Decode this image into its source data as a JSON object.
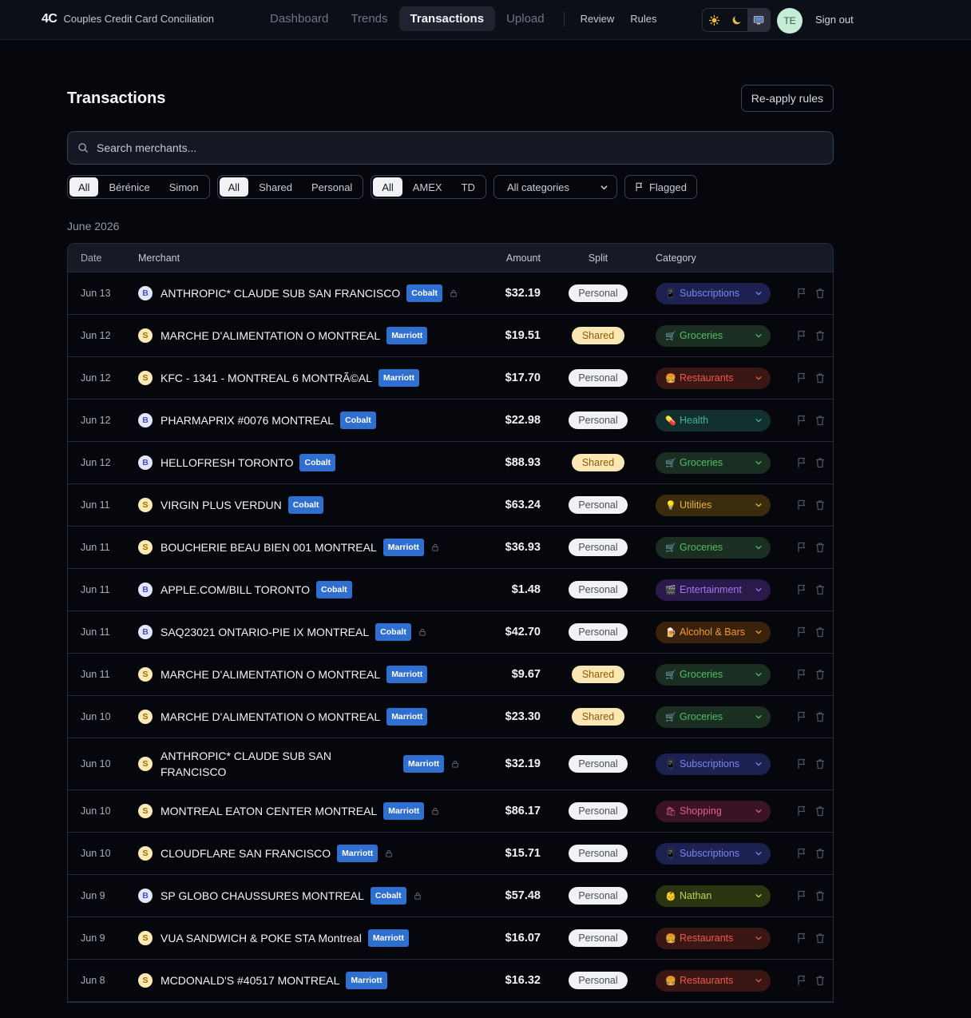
{
  "brand": {
    "logo": "4C",
    "name": "Couples Credit Card Conciliation"
  },
  "nav": {
    "tabs": [
      {
        "label": "Dashboard",
        "active": false
      },
      {
        "label": "Trends",
        "active": false
      },
      {
        "label": "Transactions",
        "active": true
      },
      {
        "label": "Upload",
        "active": false
      }
    ],
    "links": [
      "Review",
      "Rules"
    ],
    "theme_icons": [
      "sun-icon",
      "moon-icon",
      "monitor-icon"
    ],
    "theme_active": "monitor-icon",
    "avatar": "TE",
    "signout": "Sign out"
  },
  "page": {
    "title": "Transactions",
    "reapply": "Re-apply rules",
    "search_placeholder": "Search merchants...",
    "month": "June 2026"
  },
  "filters": {
    "person": {
      "options": [
        "All",
        "Bérénice",
        "Simon"
      ],
      "active": 0
    },
    "split": {
      "options": [
        "All",
        "Shared",
        "Personal"
      ],
      "active": 0
    },
    "card": {
      "options": [
        "All",
        "AMEX",
        "TD"
      ],
      "active": 0
    },
    "category_select": "All categories",
    "flagged": "Flagged"
  },
  "table": {
    "headers": {
      "date": "Date",
      "merchant": "Merchant",
      "amount": "Amount",
      "split": "Split",
      "category": "Category"
    },
    "rows": [
      {
        "date": "Jun 13",
        "person": "B",
        "merchant": "ANTHROPIC* CLAUDE SUB SAN FRANCISCO",
        "card": "Cobalt",
        "locked": true,
        "amount": "$32.19",
        "split": "Personal",
        "category": "Subscriptions",
        "emoji": "📱"
      },
      {
        "date": "Jun 12",
        "person": "S",
        "merchant": "MARCHE D'ALIMENTATION O MONTREAL",
        "card": "Marriott",
        "locked": false,
        "amount": "$19.51",
        "split": "Shared",
        "category": "Groceries",
        "emoji": "🛒"
      },
      {
        "date": "Jun 12",
        "person": "S",
        "merchant": "KFC - 1341 - MONTREAL 6 MONTRÃ©AL",
        "card": "Marriott",
        "locked": false,
        "amount": "$17.70",
        "split": "Personal",
        "category": "Restaurants",
        "emoji": "🍔"
      },
      {
        "date": "Jun 12",
        "person": "B",
        "merchant": "PHARMAPRIX #0076 MONTREAL",
        "card": "Cobalt",
        "locked": false,
        "amount": "$22.98",
        "split": "Personal",
        "category": "Health",
        "emoji": "💊"
      },
      {
        "date": "Jun 12",
        "person": "B",
        "merchant": "HELLOFRESH TORONTO",
        "card": "Cobalt",
        "locked": false,
        "amount": "$88.93",
        "split": "Shared",
        "category": "Groceries",
        "emoji": "🛒"
      },
      {
        "date": "Jun 11",
        "person": "S",
        "merchant": "VIRGIN PLUS VERDUN",
        "card": "Cobalt",
        "locked": false,
        "amount": "$63.24",
        "split": "Personal",
        "category": "Utilities",
        "emoji": "💡"
      },
      {
        "date": "Jun 11",
        "person": "S",
        "merchant": "BOUCHERIE BEAU BIEN 001 MONTREAL",
        "card": "Marriott",
        "locked": true,
        "amount": "$36.93",
        "split": "Personal",
        "category": "Groceries",
        "emoji": "🛒"
      },
      {
        "date": "Jun 11",
        "person": "B",
        "merchant": "APPLE.COM/BILL TORONTO",
        "card": "Cobalt",
        "locked": false,
        "amount": "$1.48",
        "split": "Personal",
        "category": "Entertainment",
        "emoji": "🎬"
      },
      {
        "date": "Jun 11",
        "person": "B",
        "merchant": "SAQ23021 ONTARIO-PIE IX MONTREAL",
        "card": "Cobalt",
        "locked": true,
        "amount": "$42.70",
        "split": "Personal",
        "category": "Alcohol & Bars",
        "emoji": "🍺"
      },
      {
        "date": "Jun 11",
        "person": "S",
        "merchant": "MARCHE D'ALIMENTATION O MONTREAL",
        "card": "Marriott",
        "locked": false,
        "amount": "$9.67",
        "split": "Shared",
        "category": "Groceries",
        "emoji": "🛒"
      },
      {
        "date": "Jun 10",
        "person": "S",
        "merchant": "MARCHE D'ALIMENTATION O MONTREAL",
        "card": "Marriott",
        "locked": false,
        "amount": "$23.30",
        "split": "Shared",
        "category": "Groceries",
        "emoji": "🛒"
      },
      {
        "date": "Jun 10",
        "person": "S",
        "merchant": "ANTHROPIC* CLAUDE SUB SAN FRANCISCO",
        "card": "Marriott",
        "locked": true,
        "amount": "$32.19",
        "split": "Personal",
        "category": "Subscriptions",
        "emoji": "📱",
        "wrap": true
      },
      {
        "date": "Jun 10",
        "person": "S",
        "merchant": "MONTREAL EATON CENTER MONTREAL",
        "card": "Marriott",
        "locked": true,
        "amount": "$86.17",
        "split": "Personal",
        "category": "Shopping",
        "emoji": "🛍"
      },
      {
        "date": "Jun 10",
        "person": "S",
        "merchant": "CLOUDFLARE SAN FRANCISCO",
        "card": "Marriott",
        "locked": true,
        "amount": "$15.71",
        "split": "Personal",
        "category": "Subscriptions",
        "emoji": "📱"
      },
      {
        "date": "Jun 9",
        "person": "B",
        "merchant": "SP GLOBO CHAUSSURES MONTREAL",
        "card": "Cobalt",
        "locked": true,
        "amount": "$57.48",
        "split": "Personal",
        "category": "Nathan",
        "emoji": "👶"
      },
      {
        "date": "Jun 9",
        "person": "S",
        "merchant": "VUA SANDWICH & POKE STA Montreal",
        "card": "Marriott",
        "locked": false,
        "amount": "$16.07",
        "split": "Personal",
        "category": "Restaurants",
        "emoji": "🍔"
      },
      {
        "date": "Jun 8",
        "person": "S",
        "merchant": "MCDONALD'S #40517 MONTREAL",
        "card": "Marriott",
        "locked": false,
        "amount": "$16.32",
        "split": "Personal",
        "category": "Restaurants",
        "emoji": "🍔"
      }
    ]
  },
  "category_colors": {
    "Subscriptions": {
      "bg": "#1c2150",
      "fg": "#7c86f0"
    },
    "Groceries": {
      "bg": "#1a2e22",
      "fg": "#4fbf63"
    },
    "Restaurants": {
      "bg": "#3a1614",
      "fg": "#ef5a48"
    },
    "Health": {
      "bg": "#13302e",
      "fg": "#3bb2a2"
    },
    "Utilities": {
      "bg": "#3a2c0c",
      "fg": "#eab334"
    },
    "Entertainment": {
      "bg": "#2a1a4a",
      "fg": "#a673f2"
    },
    "Alcohol & Bars": {
      "bg": "#3a220c",
      "fg": "#f29a3a"
    },
    "Shopping": {
      "bg": "#3a1426",
      "fg": "#e35d95"
    },
    "Nathan": {
      "bg": "#2a3411",
      "fg": "#b6d84a"
    }
  }
}
